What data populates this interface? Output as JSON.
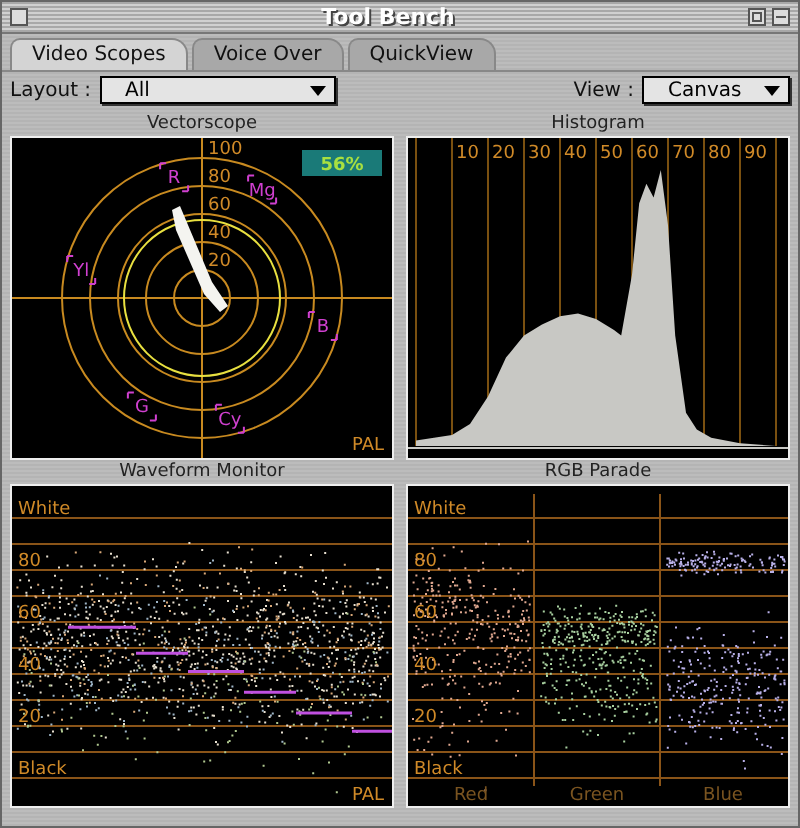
{
  "window": {
    "title": "Tool Bench"
  },
  "tabs": [
    {
      "label": "Video Scopes",
      "selected": true
    },
    {
      "label": "Voice Over",
      "selected": false
    },
    {
      "label": "QuickView",
      "selected": false
    }
  ],
  "layout": {
    "label": "Layout :",
    "value": "All"
  },
  "view": {
    "label": "View :",
    "value": "Canvas"
  },
  "vectorscope": {
    "title": "Vectorscope",
    "rings": [
      "100",
      "80",
      "60",
      "40",
      "20"
    ],
    "targets": [
      "R",
      "Mg",
      "B",
      "Cy",
      "G",
      "Yl"
    ],
    "saturation": "56%",
    "standard": "PAL"
  },
  "histogram": {
    "title": "Histogram",
    "ticks": [
      "10",
      "20",
      "30",
      "40",
      "50",
      "60",
      "70",
      "80",
      "90"
    ]
  },
  "waveform": {
    "title": "Waveform Monitor",
    "levels": [
      "White",
      "80",
      "60",
      "40",
      "20",
      "Black"
    ],
    "standard": "PAL"
  },
  "rgb_parade": {
    "title": "RGB Parade",
    "levels": [
      "White",
      "80",
      "60",
      "40",
      "20",
      "Black"
    ],
    "channels": [
      "Red",
      "Green",
      "Blue"
    ]
  }
}
